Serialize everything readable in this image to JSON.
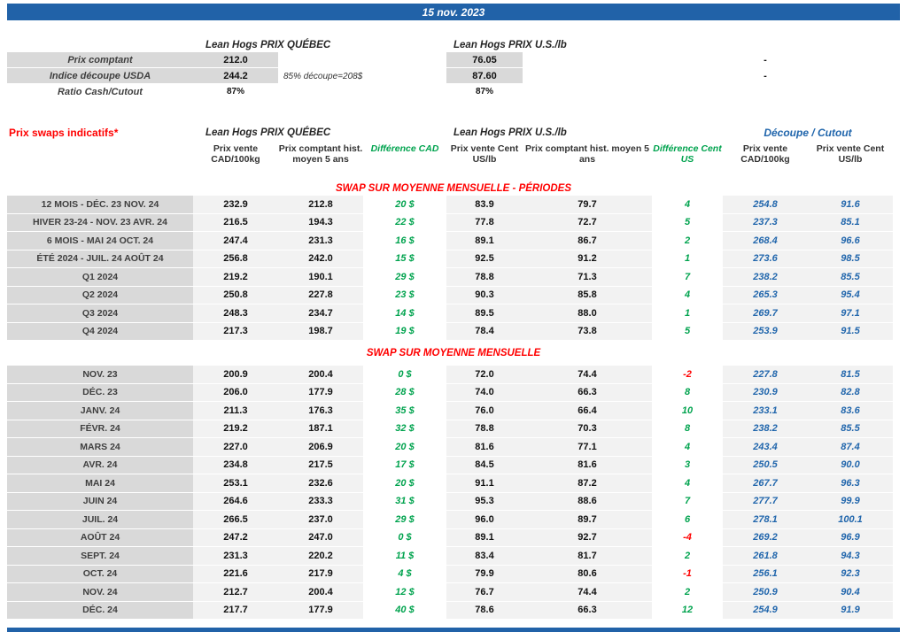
{
  "banner": {
    "date": "15 nov. 2023"
  },
  "spot": {
    "quebec_title": "Lean Hogs PRIX QUÉBEC",
    "us_title": "Lean Hogs PRIX U.S./lb",
    "rows": [
      {
        "label": "Prix comptant",
        "qc_value": "212.0",
        "note": "",
        "us_value": "76.05",
        "cutout_value": "-"
      },
      {
        "label": "Indice découpe USDA",
        "qc_value": "244.2",
        "note": "85% découpe=208$",
        "us_value": "87.60",
        "cutout_value": "-"
      },
      {
        "label": "Ratio Cash/Cutout",
        "qc_value": "87%",
        "note": "",
        "us_value": "87%",
        "cutout_value": ""
      }
    ]
  },
  "swaps": {
    "title": "Prix swaps indicatifs*",
    "quebec_title": "Lean Hogs PRIX QUÉBEC",
    "us_title": "Lean Hogs PRIX U.S./lb",
    "cutout_title": "Découpe / Cutout",
    "columns": [
      "Prix vente CAD/100kg",
      "Prix comptant hist. moyen 5 ans",
      "Différence CAD",
      "Prix vente Cent US/lb",
      "Prix comptant hist. moyen 5 ans",
      "Différence Cent US",
      "Prix vente CAD/100kg",
      "Prix vente Cent US/lb"
    ],
    "sections": {
      "periods": "SWAP SUR MOYENNE MENSUELLE - PÉRIODES",
      "monthly": "SWAP SUR MOYENNE MENSUELLE"
    },
    "period_rows": [
      {
        "label": "12 MOIS - DÉC. 23 NOV. 24",
        "cad": "232.9",
        "cad_hist": "212.8",
        "diff_cad": "20 $",
        "us": "83.9",
        "us_hist": "79.7",
        "diff_us": "4",
        "cutout_cad": "254.8",
        "cutout_us": "91.6"
      },
      {
        "label": "HIVER 23-24 - NOV. 23 AVR. 24",
        "cad": "216.5",
        "cad_hist": "194.3",
        "diff_cad": "22 $",
        "us": "77.8",
        "us_hist": "72.7",
        "diff_us": "5",
        "cutout_cad": "237.3",
        "cutout_us": "85.1"
      },
      {
        "label": "6 MOIS - MAI 24 OCT. 24",
        "cad": "247.4",
        "cad_hist": "231.3",
        "diff_cad": "16 $",
        "us": "89.1",
        "us_hist": "86.7",
        "diff_us": "2",
        "cutout_cad": "268.4",
        "cutout_us": "96.6"
      },
      {
        "label": "ÉTÉ 2024 - JUIL. 24 AOÛT 24",
        "cad": "256.8",
        "cad_hist": "242.0",
        "diff_cad": "15 $",
        "us": "92.5",
        "us_hist": "91.2",
        "diff_us": "1",
        "cutout_cad": "273.6",
        "cutout_us": "98.5"
      },
      {
        "label": "Q1 2024",
        "cad": "219.2",
        "cad_hist": "190.1",
        "diff_cad": "29 $",
        "us": "78.8",
        "us_hist": "71.3",
        "diff_us": "7",
        "cutout_cad": "238.2",
        "cutout_us": "85.5"
      },
      {
        "label": "Q2 2024",
        "cad": "250.8",
        "cad_hist": "227.8",
        "diff_cad": "23 $",
        "us": "90.3",
        "us_hist": "85.8",
        "diff_us": "4",
        "cutout_cad": "265.3",
        "cutout_us": "95.4"
      },
      {
        "label": "Q3 2024",
        "cad": "248.3",
        "cad_hist": "234.7",
        "diff_cad": "14 $",
        "us": "89.5",
        "us_hist": "88.0",
        "diff_us": "1",
        "cutout_cad": "269.7",
        "cutout_us": "97.1"
      },
      {
        "label": "Q4 2024",
        "cad": "217.3",
        "cad_hist": "198.7",
        "diff_cad": "19 $",
        "us": "78.4",
        "us_hist": "73.8",
        "diff_us": "5",
        "cutout_cad": "253.9",
        "cutout_us": "91.5"
      }
    ],
    "monthly_rows": [
      {
        "label": "NOV. 23",
        "cad": "200.9",
        "cad_hist": "200.4",
        "diff_cad": "0 $",
        "us": "72.0",
        "us_hist": "74.4",
        "diff_us": "-2",
        "cutout_cad": "227.8",
        "cutout_us": "81.5"
      },
      {
        "label": "DÉC. 23",
        "cad": "206.0",
        "cad_hist": "177.9",
        "diff_cad": "28 $",
        "us": "74.0",
        "us_hist": "66.3",
        "diff_us": "8",
        "cutout_cad": "230.9",
        "cutout_us": "82.8"
      },
      {
        "label": "JANV. 24",
        "cad": "211.3",
        "cad_hist": "176.3",
        "diff_cad": "35 $",
        "us": "76.0",
        "us_hist": "66.4",
        "diff_us": "10",
        "cutout_cad": "233.1",
        "cutout_us": "83.6"
      },
      {
        "label": "FÉVR. 24",
        "cad": "219.2",
        "cad_hist": "187.1",
        "diff_cad": "32 $",
        "us": "78.8",
        "us_hist": "70.3",
        "diff_us": "8",
        "cutout_cad": "238.2",
        "cutout_us": "85.5"
      },
      {
        "label": "MARS 24",
        "cad": "227.0",
        "cad_hist": "206.9",
        "diff_cad": "20 $",
        "us": "81.6",
        "us_hist": "77.1",
        "diff_us": "4",
        "cutout_cad": "243.4",
        "cutout_us": "87.4"
      },
      {
        "label": "AVR. 24",
        "cad": "234.8",
        "cad_hist": "217.5",
        "diff_cad": "17 $",
        "us": "84.5",
        "us_hist": "81.6",
        "diff_us": "3",
        "cutout_cad": "250.5",
        "cutout_us": "90.0"
      },
      {
        "label": "MAI 24",
        "cad": "253.1",
        "cad_hist": "232.6",
        "diff_cad": "20 $",
        "us": "91.1",
        "us_hist": "87.2",
        "diff_us": "4",
        "cutout_cad": "267.7",
        "cutout_us": "96.3"
      },
      {
        "label": "JUIN 24",
        "cad": "264.6",
        "cad_hist": "233.3",
        "diff_cad": "31 $",
        "us": "95.3",
        "us_hist": "88.6",
        "diff_us": "7",
        "cutout_cad": "277.7",
        "cutout_us": "99.9"
      },
      {
        "label": "JUIL. 24",
        "cad": "266.5",
        "cad_hist": "237.0",
        "diff_cad": "29 $",
        "us": "96.0",
        "us_hist": "89.7",
        "diff_us": "6",
        "cutout_cad": "278.1",
        "cutout_us": "100.1"
      },
      {
        "label": "AOÛT 24",
        "cad": "247.2",
        "cad_hist": "247.0",
        "diff_cad": "0 $",
        "us": "89.1",
        "us_hist": "92.7",
        "diff_us": "-4",
        "cutout_cad": "269.2",
        "cutout_us": "96.9"
      },
      {
        "label": "SEPT. 24",
        "cad": "231.3",
        "cad_hist": "220.2",
        "diff_cad": "11 $",
        "us": "83.4",
        "us_hist": "81.7",
        "diff_us": "2",
        "cutout_cad": "261.8",
        "cutout_us": "94.3"
      },
      {
        "label": "OCT. 24",
        "cad": "221.6",
        "cad_hist": "217.9",
        "diff_cad": "4 $",
        "us": "79.9",
        "us_hist": "80.6",
        "diff_us": "-1",
        "cutout_cad": "256.1",
        "cutout_us": "92.3"
      },
      {
        "label": "NOV. 24",
        "cad": "212.7",
        "cad_hist": "200.4",
        "diff_cad": "12 $",
        "us": "76.7",
        "us_hist": "74.4",
        "diff_us": "2",
        "cutout_cad": "250.9",
        "cutout_us": "90.4"
      },
      {
        "label": "DÉC. 24",
        "cad": "217.7",
        "cad_hist": "177.9",
        "diff_cad": "40 $",
        "us": "78.6",
        "us_hist": "66.3",
        "diff_us": "12",
        "cutout_cad": "254.9",
        "cutout_us": "91.9"
      }
    ]
  },
  "colors": {
    "banner_blue": "#2162a8",
    "cutout_blue": "#2166ac",
    "positive_green": "#00a34e",
    "negative_red": "#ff0000",
    "section_red": "#ff0000",
    "label_bg": "#d9d9d9",
    "band_bg": "#f2f2f2"
  }
}
